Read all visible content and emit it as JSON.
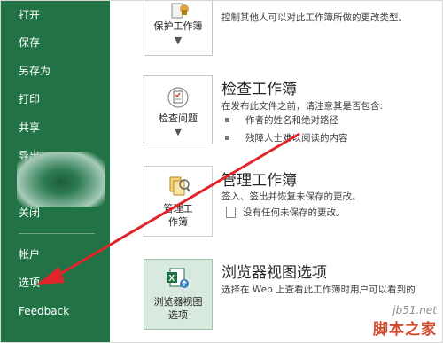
{
  "sidebar": {
    "items": [
      {
        "label": "打开"
      },
      {
        "label": "保存"
      },
      {
        "label": "另存为"
      },
      {
        "label": "打印"
      },
      {
        "label": "共享"
      },
      {
        "label": "导出"
      },
      {
        "label": "关闭"
      },
      {
        "label": "帐户"
      },
      {
        "label": "选项"
      },
      {
        "label": "Feedback"
      }
    ]
  },
  "main": {
    "protect": {
      "button_label": "保护工作簿",
      "description": "控制其他人可以对此工作簿所做的更改类型。"
    },
    "inspect": {
      "button_label": "检查问题",
      "title": "检查工作簿",
      "description": "在发布此文件之前，请注意其是否包含:",
      "bullets": [
        "作者的姓名和绝对路径",
        "残障人士难以阅读的内容"
      ]
    },
    "manage": {
      "button_label_line1": "管理工",
      "button_label_line2": "作簿",
      "title": "管理工作簿",
      "description": "签入、签出并恢复未保存的更改。",
      "status": "没有任何未保存的更改。"
    },
    "browser": {
      "button_label_line1": "浏览器视图",
      "button_label_line2": "选项",
      "title": "浏览器视图选项",
      "description": "选择在 Web 上查看此工作簿时用户可以看到的"
    }
  },
  "colors": {
    "sidebar": "#217346",
    "arrow": "#e0262a"
  },
  "watermark": {
    "url": "jb51.net",
    "name": "脚本之家"
  }
}
